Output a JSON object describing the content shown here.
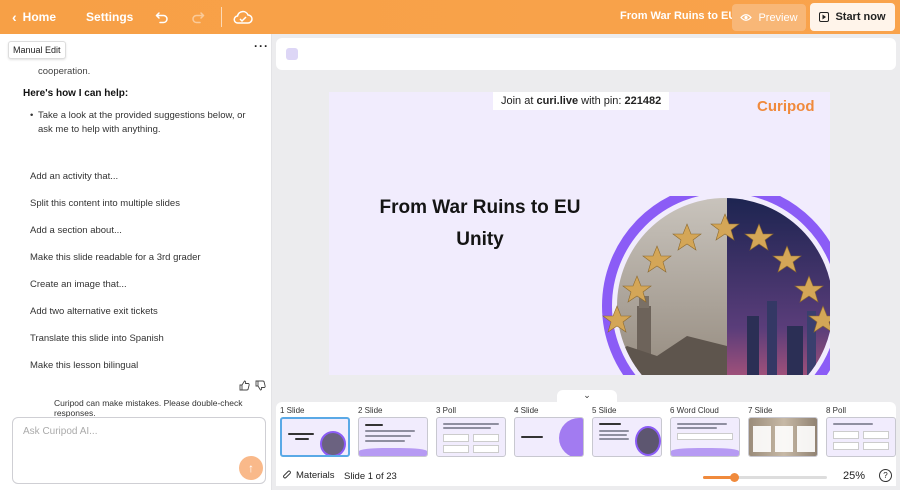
{
  "header": {
    "back_label": "Home",
    "settings_label": "Settings",
    "deck_title": "From War Ruins to EU ...",
    "preview_label": "Preview",
    "start_label": "Start now"
  },
  "assistant": {
    "mode_label": "Manual Edit",
    "intro_fragment": "cooperation.",
    "help_heading": "Here's how I can help:",
    "help_item": "Take a look at the provided suggestions below, or ask me to help with anything.",
    "suggestions": [
      "Add an activity that...",
      "Split this content into multiple slides",
      "Add a section about...",
      "Make this slide readable for a 3rd grader",
      "Create an image that...",
      "Add two alternative exit tickets",
      "Translate this slide into Spanish",
      "Make this lesson bilingual"
    ],
    "disclaimer": "Curipod can make mistakes. Please double-check responses.",
    "input_placeholder": "Ask Curipod AI..."
  },
  "slide": {
    "pin_prefix": "Join at ",
    "pin_site": "curi.live",
    "pin_mid": " with pin: ",
    "pin_code": "221482",
    "logo": "Curipod",
    "title_line1": "From War Ruins to EU",
    "title_line2": "Unity"
  },
  "thumbnails": [
    {
      "label": "1 Slide",
      "active": true
    },
    {
      "label": "2 Slide",
      "active": false
    },
    {
      "label": "3 Poll",
      "active": false
    },
    {
      "label": "4 Slide",
      "active": false
    },
    {
      "label": "5 Slide",
      "active": false
    },
    {
      "label": "6 Word Cloud",
      "active": false
    },
    {
      "label": "7 Slide",
      "active": false
    },
    {
      "label": "8 Poll",
      "active": false
    }
  ],
  "footer": {
    "materials_label": "Materials",
    "slide_counter": "Slide 1 of 23",
    "zoom_label": "25%",
    "zoom_value": 25,
    "help_label": "?"
  },
  "colors": {
    "accent_orange": "#f7a046",
    "slide_bg": "#f1ecfd",
    "purple": "#8b5cf6",
    "active_thumb": "#5aa9e6"
  }
}
